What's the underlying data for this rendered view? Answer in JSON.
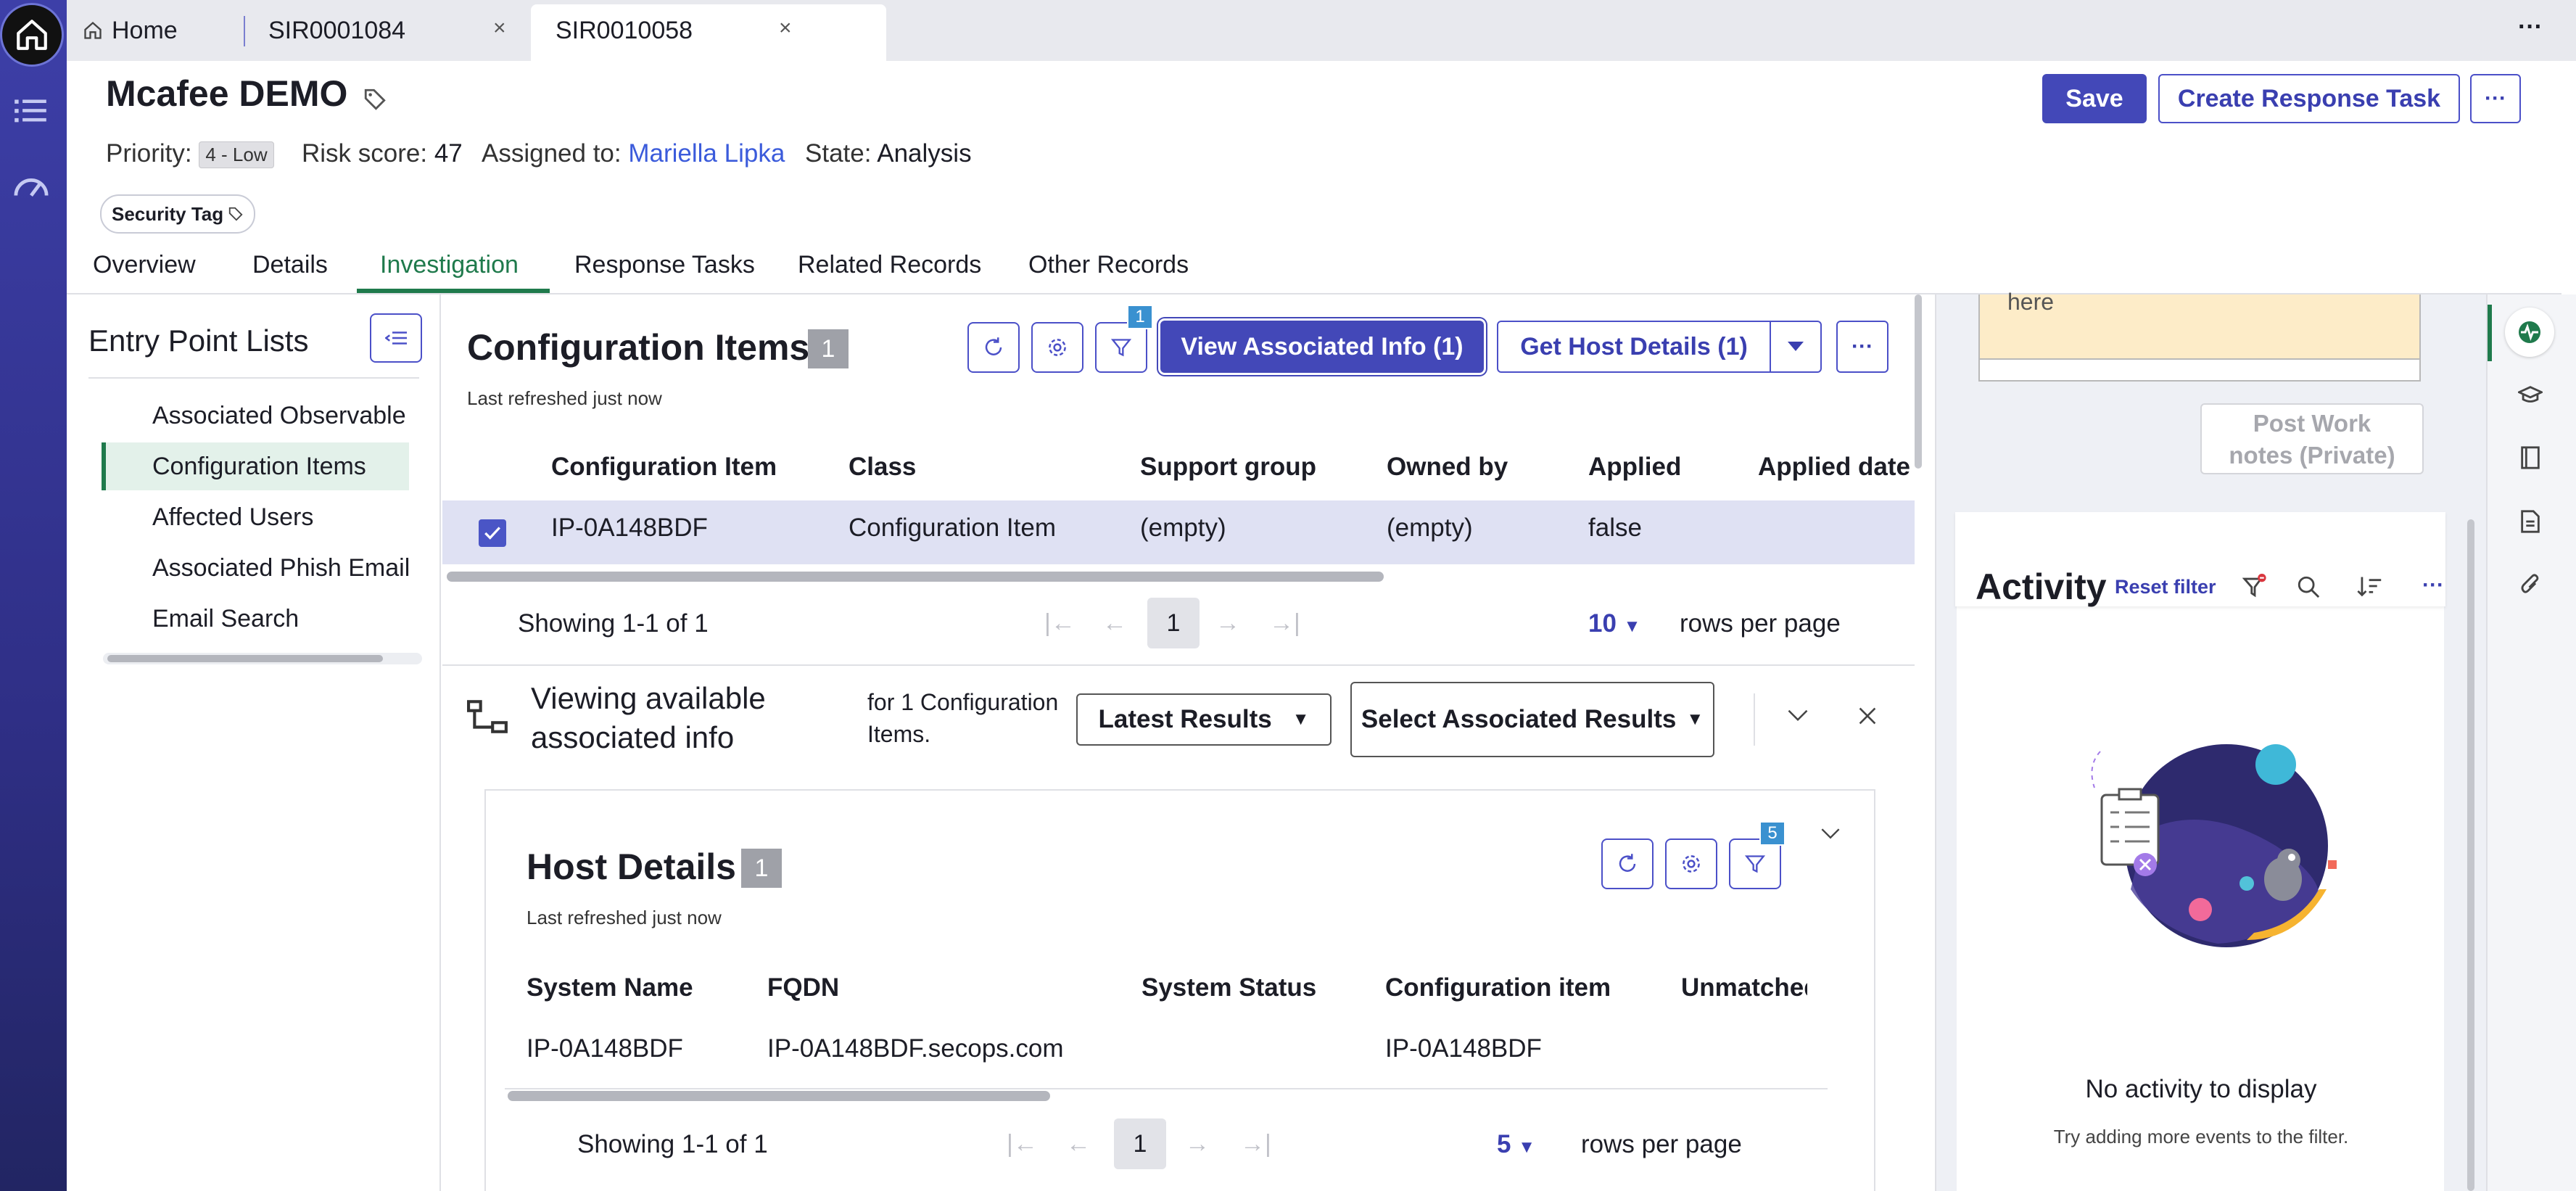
{
  "tabs": {
    "home": "Home",
    "tab1": "SIR0001084",
    "tab2": "SIR0010058",
    "close": "×",
    "more": "···"
  },
  "record": {
    "title": "Mcafee DEMO",
    "priority_label": "Priority:",
    "priority_value": "4 - Low",
    "risk_label": "Risk score:",
    "risk_value": "47",
    "assigned_label": "Assigned to:",
    "assigned_value": "Mariella Lipka",
    "state_label": "State:",
    "state_value": "Analysis",
    "security_tag": "Security Tag",
    "save": "Save",
    "create_task": "Create Response Task",
    "more": "···"
  },
  "record_tabs": [
    "Overview",
    "Details",
    "Investigation",
    "Response Tasks",
    "Related Records",
    "Other Records"
  ],
  "entry_points": {
    "title": "Entry Point Lists",
    "items": [
      "Associated Observable",
      "Configuration Items",
      "Affected Users",
      "Associated Phish Email",
      "Email Search"
    ],
    "selected": "Configuration Items"
  },
  "ci": {
    "title": "Configuration Items",
    "count": "1",
    "refreshed": "Last refreshed just now",
    "filter_badge": "1",
    "view_assoc": "View Associated Info (1)",
    "get_host": "Get Host Details (1)",
    "columns": [
      "Configuration Item",
      "Class",
      "Support group",
      "Owned by",
      "Applied",
      "Applied date"
    ],
    "row": [
      "IP-0A148BDF",
      "Configuration Item",
      "(empty)",
      "(empty)",
      "false",
      ""
    ],
    "showing": "Showing 1-1 of 1",
    "page": "1",
    "rows_per_page_value": "10",
    "rows_per_page_label": "rows per page"
  },
  "assoc": {
    "title_line1": "Viewing available",
    "title_line2": "associated info",
    "for_line1": "for 1 Configuration",
    "for_line2": "Items.",
    "latest": "Latest Results",
    "select": "Select Associated Results"
  },
  "host": {
    "title": "Host Details",
    "count": "1",
    "refreshed": "Last refreshed just now",
    "filter_badge": "5",
    "columns": [
      "System Name",
      "FQDN",
      "System Status",
      "Configuration item",
      "Unmatched"
    ],
    "row": [
      "IP-0A148BDF",
      "IP-0A148BDF.secops.com",
      "",
      "IP-0A148BDF"
    ],
    "showing": "Showing 1-1 of 1",
    "page": "1",
    "rows_per_page_value": "5",
    "rows_per_page_label": "rows per page"
  },
  "worknotes": {
    "text": "here",
    "post_line1": "Post Work",
    "post_line2": "notes (Private)"
  },
  "activity": {
    "title": "Activity",
    "reset": "Reset filter",
    "empty_title": "No activity to display",
    "empty_sub": "Try adding more events to the filter."
  },
  "colors": {
    "accent": "#4348b8",
    "link": "#3b5bdb",
    "selected_row": "#dfe1f3",
    "active_tab": "#1f7a4c"
  }
}
